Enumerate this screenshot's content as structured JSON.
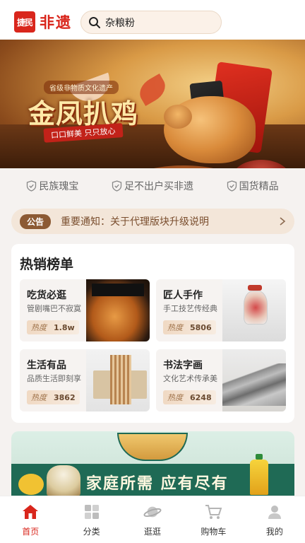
{
  "header": {
    "logo_badge": "捷民",
    "logo_text": "非遗",
    "search_value": "杂粮粉"
  },
  "banner": {
    "subtitle": "省级非物质文化遗产",
    "title": "金凤扒鸡",
    "slogan": "口口鲜美 只只放心"
  },
  "tags": [
    {
      "icon": "shield-check-icon",
      "label": "民族瑰宝"
    },
    {
      "icon": "shield-check-icon",
      "label": "足不出户买非遗"
    },
    {
      "icon": "shield-check-icon",
      "label": "国货精品"
    }
  ],
  "notice": {
    "badge": "公告",
    "text": "重要通知：关于代理版块升级说明"
  },
  "hot_list": {
    "title": "热销榜单",
    "heat_label": "热度",
    "items": [
      {
        "name": "吃货必逛",
        "desc": "管剧嘴巴不寂寞",
        "heat": "1.8w",
        "image": "braised-chicken"
      },
      {
        "name": "匠人手作",
        "desc": "手工技艺传经典",
        "heat": "5806",
        "image": "snuff-bottle"
      },
      {
        "name": "生活有品",
        "desc": "品质生活即刻享",
        "heat": "3862",
        "image": "chopsticks"
      },
      {
        "name": "书法字画",
        "desc": "文化艺术传承美",
        "heat": "6248",
        "image": "landscape-painting"
      }
    ]
  },
  "promo": {
    "text": "家庭所需 应有尽有"
  },
  "tabbar": {
    "active": "首页",
    "items": [
      {
        "icon": "home-icon",
        "label": "首页"
      },
      {
        "icon": "category-icon",
        "label": "分类"
      },
      {
        "icon": "planet-icon",
        "label": "逛逛"
      },
      {
        "icon": "cart-icon",
        "label": "购物车"
      },
      {
        "icon": "user-icon",
        "label": "我的"
      }
    ]
  },
  "colors": {
    "brand": "#d9261c",
    "accent_brown": "#8c5a34",
    "background": "#f5f2f0"
  }
}
